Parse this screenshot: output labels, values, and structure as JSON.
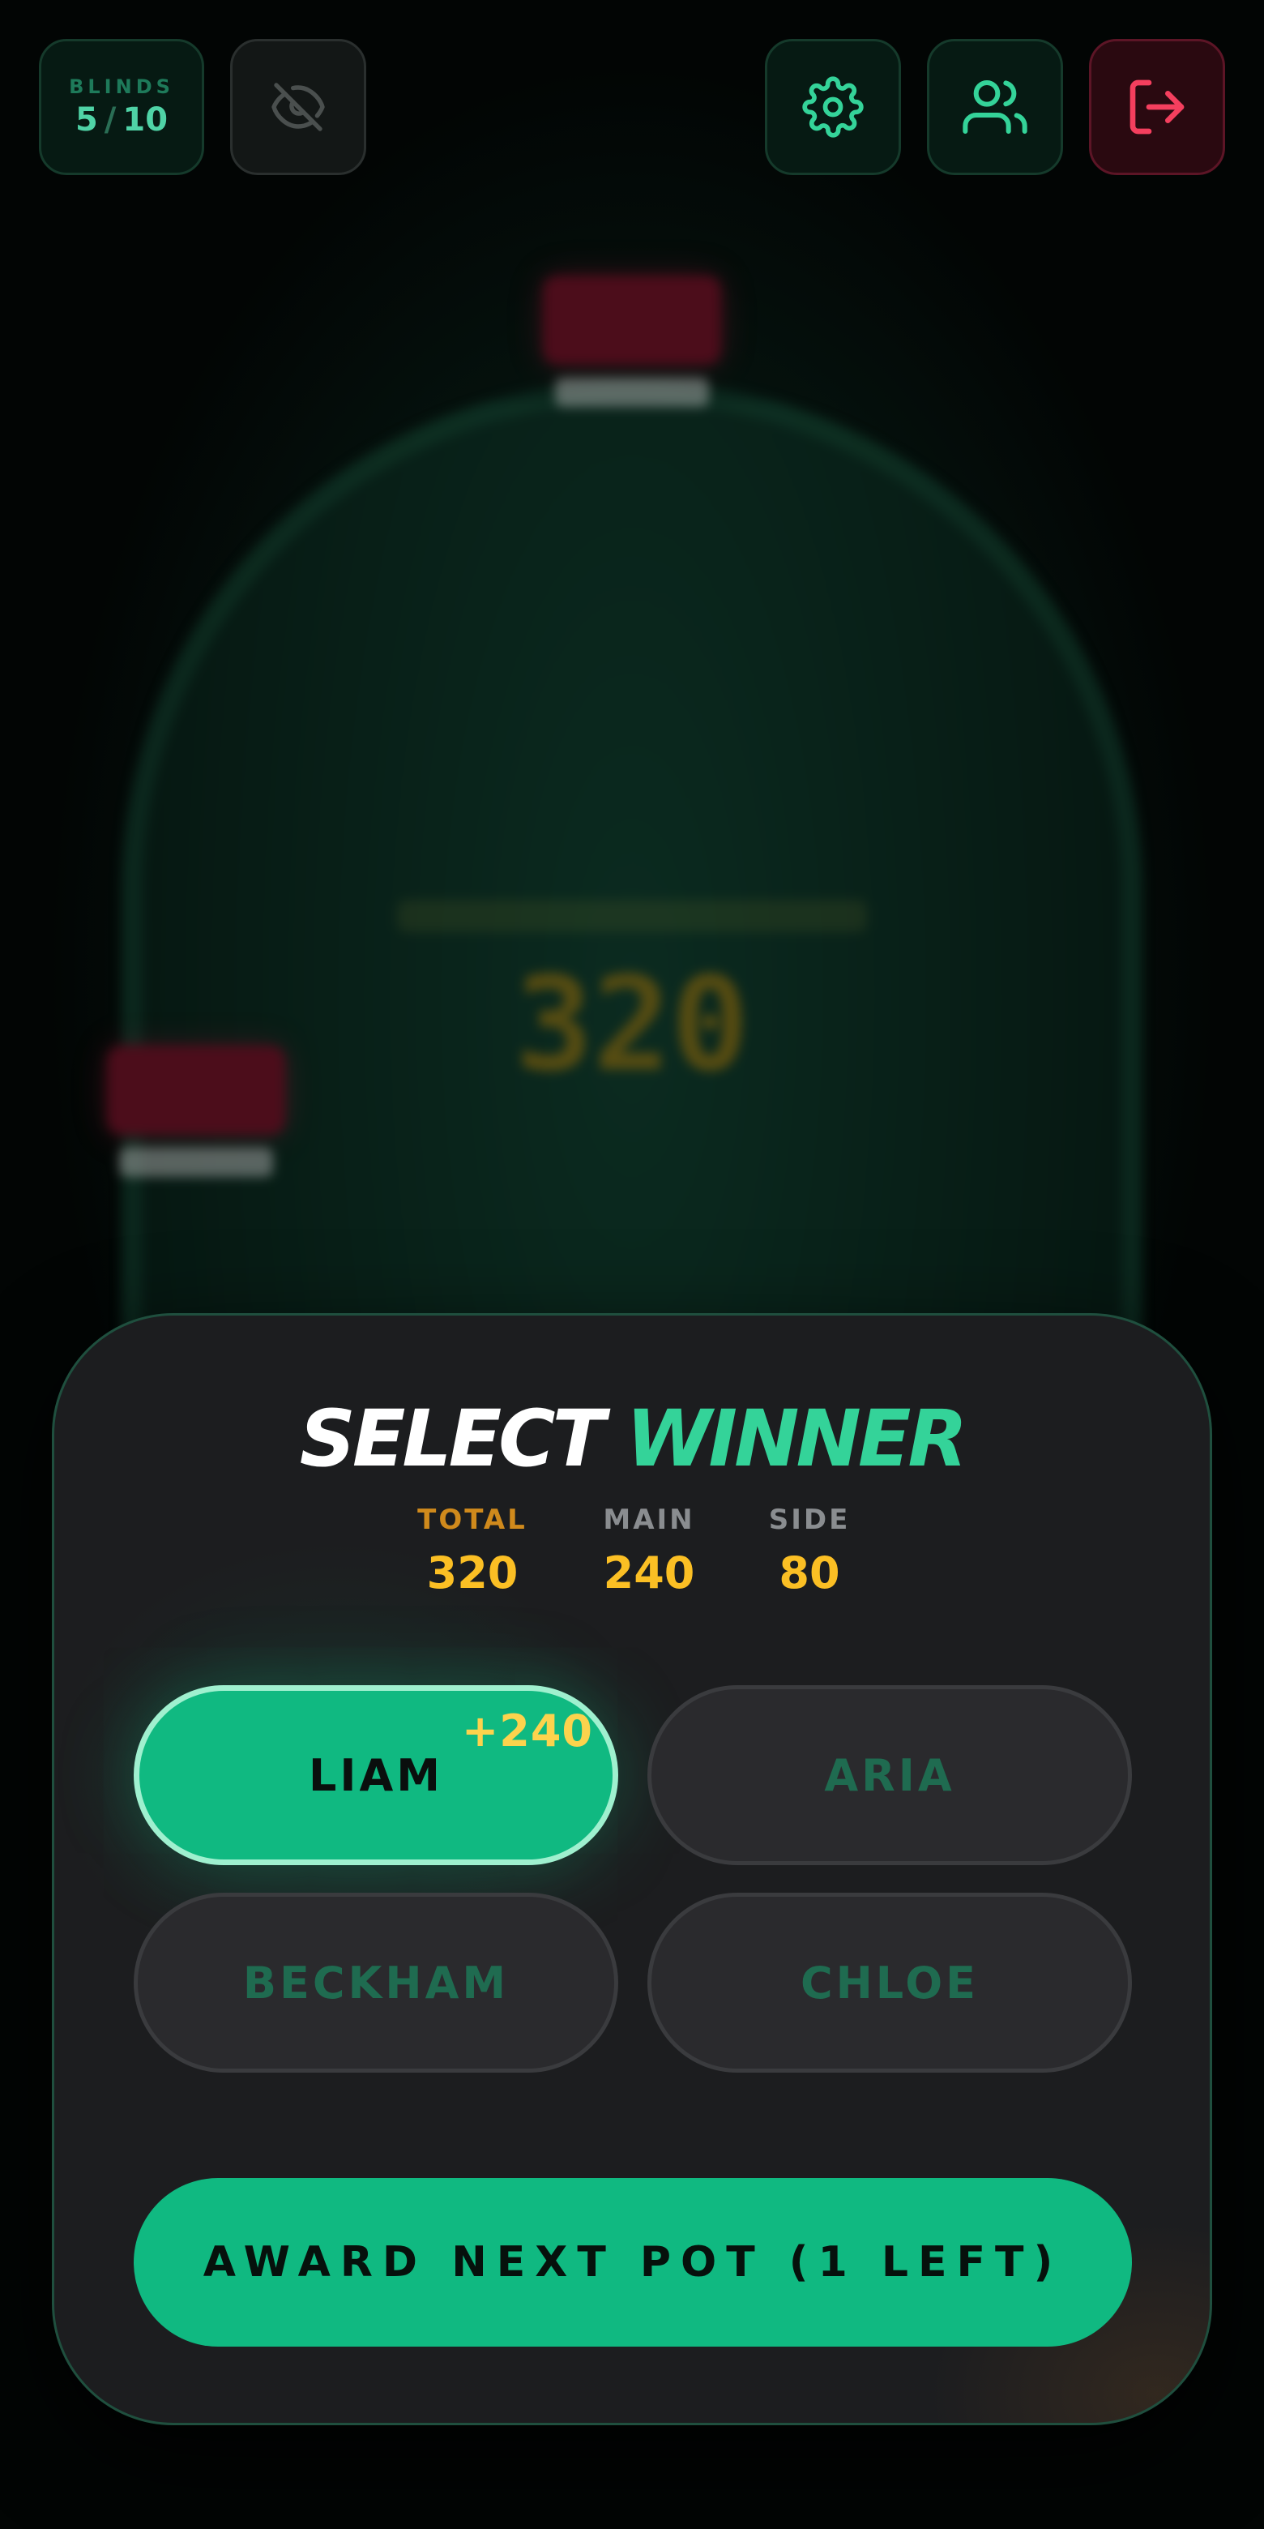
{
  "header": {
    "blinds": {
      "label": "BLINDS",
      "small": "5",
      "separator": "/",
      "big": "10"
    },
    "visibility_icon": "eye-off-icon",
    "settings_icon": "gear-icon",
    "players_icon": "users-icon",
    "exit_icon": "log-out-icon"
  },
  "table": {
    "pot_amount": "320"
  },
  "modal": {
    "title_part1": "SELECT",
    "title_part2": "WINNER",
    "stats": [
      {
        "label": "TOTAL",
        "value": "320"
      },
      {
        "label": "MAIN",
        "value": "240"
      },
      {
        "label": "SIDE",
        "value": "80"
      }
    ],
    "players": [
      {
        "name": "LIAM",
        "award": "+240",
        "selected": true
      },
      {
        "name": "ARIA",
        "selected": false
      },
      {
        "name": "BECKHAM",
        "selected": false
      },
      {
        "name": "CHLOE",
        "selected": false
      }
    ],
    "award_button": "AWARD NEXT POT (1 LEFT)"
  },
  "colors": {
    "accent": "#10b981",
    "accent_text": "#34d399",
    "gold": "#fbbf24",
    "danger": "#f43f5e",
    "panel": "#1c1d1f"
  }
}
